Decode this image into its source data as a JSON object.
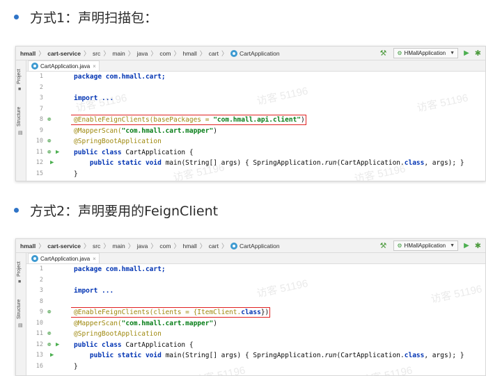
{
  "section1": {
    "label": "方式1：声明扫描包："
  },
  "section2": {
    "label": "方式2：声明要用的FeignClient"
  },
  "ide": {
    "breadcrumbs": [
      "hmall",
      "cart-service",
      "src",
      "main",
      "java",
      "com",
      "hmall",
      "cart",
      "CartApplication"
    ],
    "run_config": "HMallApplication",
    "tab": "CartApplication.java",
    "side_labels": [
      "Project",
      "Structure"
    ],
    "watermark": "访客 51196"
  },
  "code1": {
    "line_numbers": [
      "1",
      "2",
      "3",
      "7",
      "8",
      "9",
      "10",
      "11",
      "12",
      "15"
    ],
    "package": "package com.hmall.cart;",
    "import": "import ...",
    "enable_pre": "@EnableFeignClients(basePackages = ",
    "enable_str": "\"com.hmall.api.client\"",
    "enable_post": ")",
    "mapper_pre": "@MapperScan(",
    "mapper_str": "\"com.hmall.cart.mapper\"",
    "mapper_post": ")",
    "boot": "@SpringBootApplication",
    "class_kw": "public class",
    "class_name": " CartApplication {",
    "main_kw": "public static void",
    "main_sig": " main(String[] args) { SpringApplication.",
    "run": "run",
    "main_args": "(CartApplication.",
    "class_word": "class",
    "main_end": ", args); }",
    "close": "}"
  },
  "code2": {
    "line_numbers": [
      "1",
      "2",
      "3",
      "8",
      "9",
      "10",
      "11",
      "12",
      "13",
      "16"
    ],
    "package": "package com.hmall.cart;",
    "import": "import ...",
    "enable_pre": "@EnableFeignClients(clients = {ItemClient.",
    "enable_kw": "class",
    "enable_post": "})",
    "mapper_pre": "@MapperScan(",
    "mapper_str": "\"com.hmall.cart.mapper\"",
    "mapper_post": ")",
    "boot": "@SpringBootApplication",
    "class_kw": "public class",
    "class_name": " CartApplication {",
    "main_kw": "public static void",
    "main_sig": " main(String[] args) { SpringApplication.",
    "run": "run",
    "main_args": "(CartApplication.",
    "class_word": "class",
    "main_end": ", args); }",
    "close": "}"
  },
  "colors": {
    "bullet": "#2f74c7",
    "keyword": "#0033b3",
    "annotation": "#9e880d",
    "string": "#067d17",
    "highlight": "#e02020"
  }
}
